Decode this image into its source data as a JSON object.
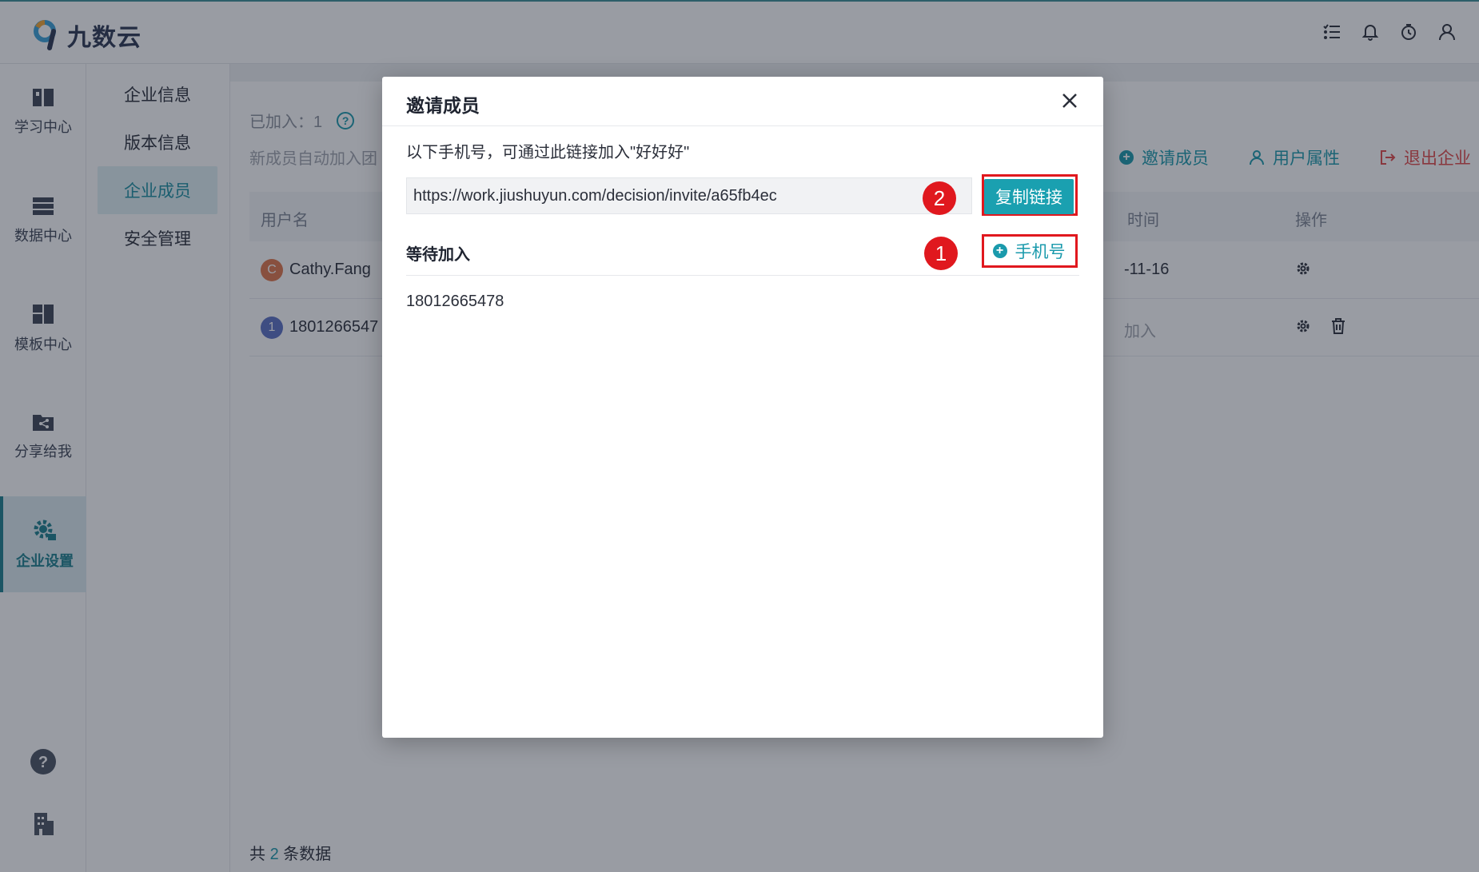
{
  "app": {
    "logo_text": "九数云",
    "brand_color": "#1a9aac"
  },
  "topbar": {
    "icons": [
      "list-icon",
      "bell-icon",
      "timer-icon",
      "user-icon"
    ]
  },
  "rail": {
    "items": [
      {
        "label": "学习中心",
        "icon": "book-icon"
      },
      {
        "label": "数据中心",
        "icon": "database-icon"
      },
      {
        "label": "模板中心",
        "icon": "template-icon"
      },
      {
        "label": "分享给我",
        "icon": "share-icon"
      },
      {
        "label": "企业设置",
        "icon": "gear-icon",
        "active": true
      }
    ],
    "bottom_icons": [
      "help-icon",
      "building-icon"
    ]
  },
  "submenu": {
    "items": [
      {
        "label": "企业信息"
      },
      {
        "label": "版本信息"
      },
      {
        "label": "企业成员",
        "active": true
      },
      {
        "label": "安全管理"
      }
    ]
  },
  "main": {
    "joined_label": "已加入：1",
    "auto_join_text": "新成员自动加入团",
    "actions": {
      "invite": "邀请成员",
      "user_attr": "用户属性",
      "exit": "退出企业"
    },
    "table": {
      "headers": {
        "username": "用户名",
        "time": "时间",
        "ops": "操作"
      },
      "rows": [
        {
          "avatar_letter": "C",
          "avatar_color": "#e0764a",
          "name": "Cathy.Fang",
          "time": "-11-16"
        },
        {
          "avatar_letter": "1",
          "avatar_color": "#5a6fc4",
          "name": "1801266547",
          "time": "加入"
        }
      ]
    },
    "total": {
      "prefix": "共",
      "count": "2",
      "suffix": "条数据"
    }
  },
  "modal": {
    "title": "邀请成员",
    "description": "以下手机号，可通过此链接加入\"好好好\"",
    "invite_link": "https://work.jiushuyun.com/decision/invite/a65fb4ec",
    "copy_button": "复制链接",
    "add_phone_button": "手机号",
    "waiting_title": "等待加入",
    "waiting_items": [
      "18012665478"
    ],
    "annotations": {
      "step1": "1",
      "step2": "2",
      "color": "#e0181e"
    }
  }
}
